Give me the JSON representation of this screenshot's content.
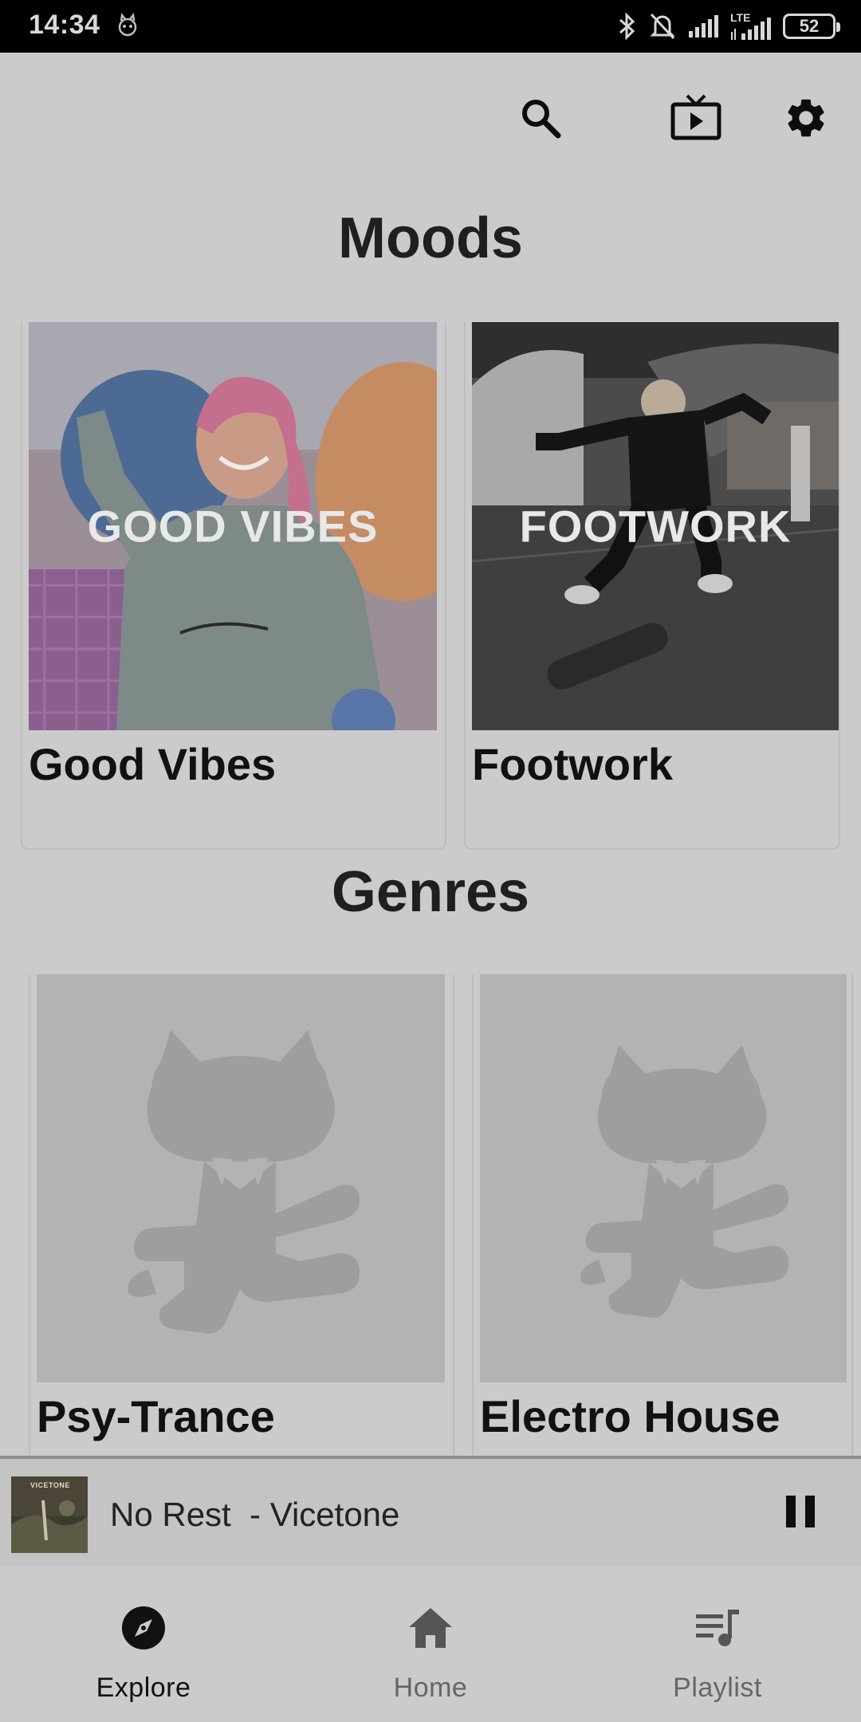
{
  "status_bar": {
    "time": "14:34",
    "network_label": "LTE",
    "battery": "52"
  },
  "toolbar": {
    "icons": [
      "search-icon",
      "cast-tv-icon",
      "settings-gear-icon"
    ]
  },
  "moods": {
    "title": "Moods",
    "items": [
      {
        "label": "Good Vibes",
        "overlay": "GOOD VIBES"
      },
      {
        "label": "Footwork",
        "overlay": "FOOTWORK"
      }
    ]
  },
  "genres": {
    "title": "Genres",
    "items": [
      {
        "label": "Psy-Trance"
      },
      {
        "label": "Electro House"
      }
    ]
  },
  "mini_player": {
    "track": "No Rest  - Vicetone",
    "art_text": "VICETONE",
    "control": "pause-icon"
  },
  "bottom_nav": {
    "items": [
      {
        "label": "Explore",
        "icon": "compass-icon",
        "active": true
      },
      {
        "label": "Home",
        "icon": "home-icon",
        "active": false
      },
      {
        "label": "Playlist",
        "icon": "queue-music-icon",
        "active": false
      }
    ]
  },
  "colors": {
    "background": "#cbcbcb",
    "status_bar": "#000000",
    "active_nav": "#111111",
    "inactive_nav": "#666666"
  }
}
